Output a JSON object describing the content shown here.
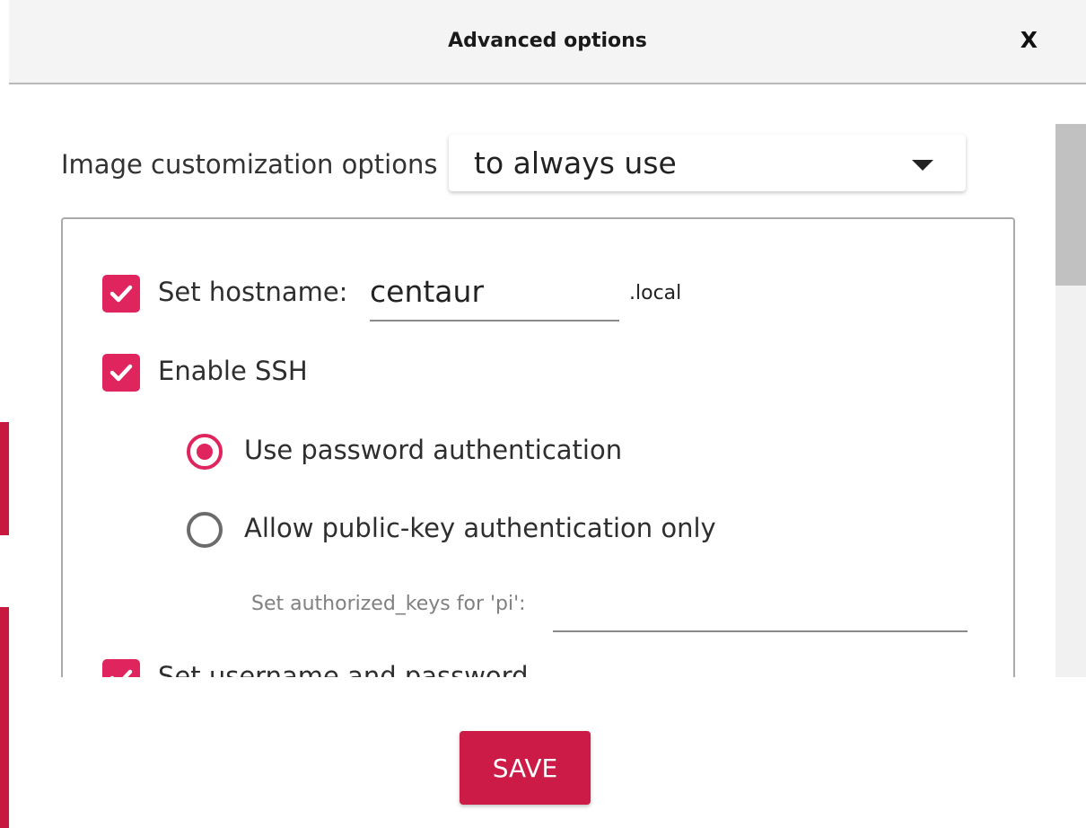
{
  "window": {
    "title": "Advanced options",
    "close_label": "X"
  },
  "customization": {
    "label": "Image customization options",
    "selected": "to always use"
  },
  "options": {
    "hostname": {
      "checked": true,
      "label": "Set hostname:",
      "value": "centaur",
      "suffix": ".local"
    },
    "ssh": {
      "checked": true,
      "label": "Enable SSH",
      "password_auth_label": "Use password authentication",
      "password_auth_selected": true,
      "pubkey_auth_label": "Allow public-key authentication only",
      "pubkey_auth_selected": false,
      "authorized_keys_label": "Set authorized_keys for 'pi':",
      "authorized_keys_value": ""
    },
    "username_password": {
      "checked": true,
      "label": "Set username and password"
    }
  },
  "footer": {
    "save_label": "SAVE"
  },
  "colors": {
    "accent": "#e0245e",
    "button": "#cc1b47"
  }
}
